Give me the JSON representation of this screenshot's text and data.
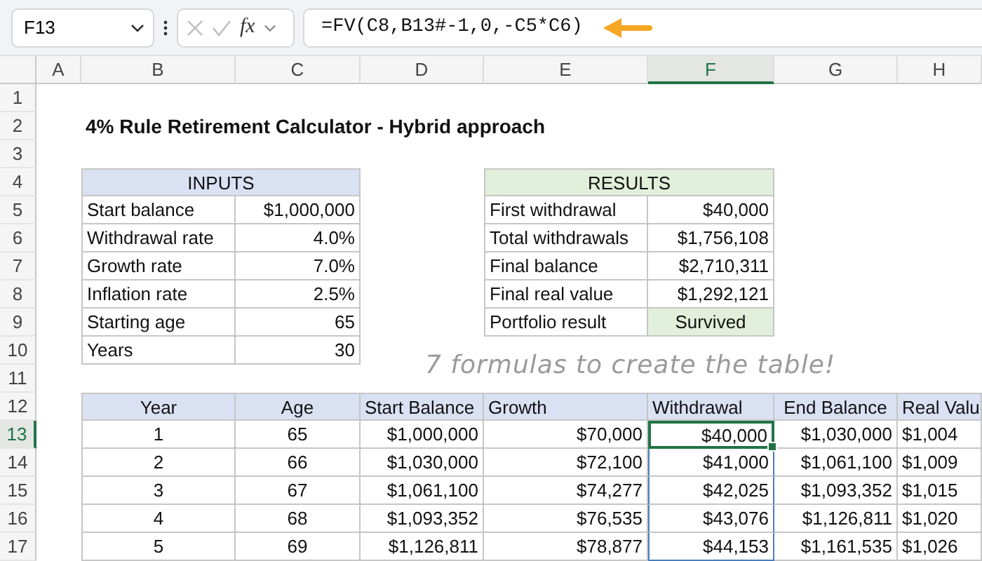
{
  "formula_bar": {
    "name_box": "F13",
    "function_label": "fx",
    "formula": "=FV(C8,B13#-1,0,-C5*C6)"
  },
  "columns": [
    {
      "label": "A",
      "selected": false
    },
    {
      "label": "B",
      "selected": false
    },
    {
      "label": "C",
      "selected": false
    },
    {
      "label": "D",
      "selected": false
    },
    {
      "label": "E",
      "selected": false
    },
    {
      "label": "F",
      "selected": true
    },
    {
      "label": "G",
      "selected": false
    },
    {
      "label": "H",
      "selected": false
    }
  ],
  "rows": [
    {
      "label": "1",
      "selected": false
    },
    {
      "label": "2",
      "selected": false
    },
    {
      "label": "3",
      "selected": false
    },
    {
      "label": "4",
      "selected": false
    },
    {
      "label": "5",
      "selected": false
    },
    {
      "label": "6",
      "selected": false
    },
    {
      "label": "7",
      "selected": false
    },
    {
      "label": "8",
      "selected": false
    },
    {
      "label": "9",
      "selected": false
    },
    {
      "label": "10",
      "selected": false
    },
    {
      "label": "11",
      "selected": false
    },
    {
      "label": "12",
      "selected": false
    },
    {
      "label": "13",
      "selected": true
    },
    {
      "label": "14",
      "selected": false
    },
    {
      "label": "15",
      "selected": false
    },
    {
      "label": "16",
      "selected": false
    },
    {
      "label": "17",
      "selected": false
    }
  ],
  "title": "4% Rule Retirement Calculator - Hybrid approach",
  "inputs": {
    "heading": "INPUTS",
    "items": [
      {
        "label": "Start balance",
        "value": "$1,000,000"
      },
      {
        "label": "Withdrawal rate",
        "value": "4.0%"
      },
      {
        "label": "Growth rate",
        "value": "7.0%"
      },
      {
        "label": "Inflation rate",
        "value": "2.5%"
      },
      {
        "label": "Starting age",
        "value": "65"
      },
      {
        "label": "Years",
        "value": "30"
      }
    ]
  },
  "results": {
    "heading": "RESULTS",
    "items": [
      {
        "label": "First withdrawal",
        "value": "$40,000",
        "highlighted": false
      },
      {
        "label": "Total withdrawals",
        "value": "$1,756,108",
        "highlighted": false
      },
      {
        "label": "Final balance",
        "value": "$2,710,311",
        "highlighted": false
      },
      {
        "label": "Final real value",
        "value": "$1,292,121",
        "highlighted": false
      },
      {
        "label": "Portfolio result",
        "value": "Survived",
        "highlighted": true
      }
    ]
  },
  "note": "7 formulas to create the table!",
  "data_table": {
    "columns": [
      {
        "label": "Year",
        "spill": false
      },
      {
        "label": "Age",
        "spill": false
      },
      {
        "label": "Start Balance",
        "spill": false
      },
      {
        "label": "Growth",
        "spill": false
      },
      {
        "label": "Withdrawal",
        "spill": true
      },
      {
        "label": "End Balance",
        "spill": false
      },
      {
        "label": "Real Valu",
        "spill": false
      }
    ],
    "rows": [
      {
        "active": true,
        "cells": [
          "1",
          "65",
          "$1,000,000",
          "$70,000",
          "$40,000",
          "$1,030,000",
          "$1,004"
        ]
      },
      {
        "active": false,
        "cells": [
          "2",
          "66",
          "$1,030,000",
          "$72,100",
          "$41,000",
          "$1,061,100",
          "$1,009"
        ]
      },
      {
        "active": false,
        "cells": [
          "3",
          "67",
          "$1,061,100",
          "$74,277",
          "$42,025",
          "$1,093,352",
          "$1,015"
        ]
      },
      {
        "active": false,
        "cells": [
          "4",
          "68",
          "$1,093,352",
          "$76,535",
          "$43,076",
          "$1,126,811",
          "$1,020"
        ]
      },
      {
        "active": false,
        "cells": [
          "5",
          "69",
          "$1,126,811",
          "$78,877",
          "$44,153",
          "$1,161,535",
          "$1,026"
        ]
      }
    ]
  }
}
